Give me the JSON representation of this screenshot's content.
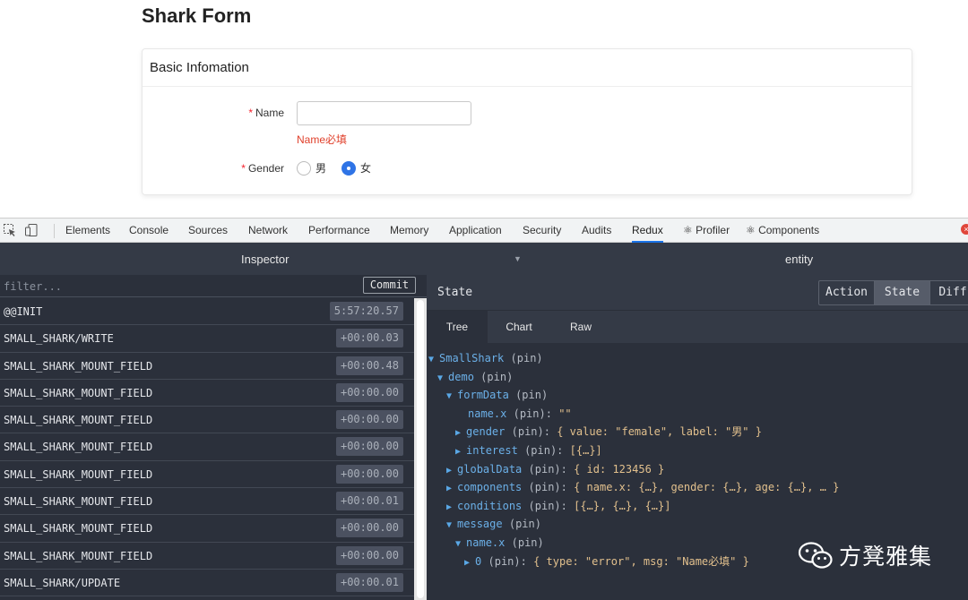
{
  "form": {
    "title": "Shark Form",
    "card_title": "Basic Infomation",
    "name_label": "Name",
    "required_mark": "*",
    "name_value": "",
    "name_error": "Name必填",
    "gender_label": "Gender",
    "gender_options": [
      {
        "label": "男",
        "selected": false
      },
      {
        "label": "女",
        "selected": true
      }
    ]
  },
  "devtools": {
    "tabs": [
      "Elements",
      "Console",
      "Sources",
      "Network",
      "Performance",
      "Memory",
      "Application",
      "Security",
      "Audits",
      "Redux",
      "⚛ Profiler",
      "⚛ Components"
    ],
    "active_tab": "Redux",
    "close_glyph": "×"
  },
  "redux": {
    "inspector_title": "Inspector",
    "entity_title": "entity",
    "filter_placeholder": "filter...",
    "commit_label": "Commit",
    "actions": [
      {
        "name": "@@INIT",
        "time": "5:57:20.57"
      },
      {
        "name": "SMALL_SHARK/WRITE",
        "time": "+00:00.03"
      },
      {
        "name": "SMALL_SHARK_MOUNT_FIELD",
        "time": "+00:00.48"
      },
      {
        "name": "SMALL_SHARK_MOUNT_FIELD",
        "time": "+00:00.00"
      },
      {
        "name": "SMALL_SHARK_MOUNT_FIELD",
        "time": "+00:00.00"
      },
      {
        "name": "SMALL_SHARK_MOUNT_FIELD",
        "time": "+00:00.00"
      },
      {
        "name": "SMALL_SHARK_MOUNT_FIELD",
        "time": "+00:00.00"
      },
      {
        "name": "SMALL_SHARK_MOUNT_FIELD",
        "time": "+00:00.01"
      },
      {
        "name": "SMALL_SHARK_MOUNT_FIELD",
        "time": "+00:00.00"
      },
      {
        "name": "SMALL_SHARK_MOUNT_FIELD",
        "time": "+00:00.00"
      },
      {
        "name": "SMALL_SHARK/UPDATE",
        "time": "+00:00.01"
      }
    ],
    "state_title": "State",
    "mode_buttons": [
      "Action",
      "State",
      "Diff"
    ],
    "active_mode": "State",
    "subtabs": [
      "Tree",
      "Chart",
      "Raw"
    ],
    "active_subtab": "Tree",
    "tree": [
      {
        "arrow": "▼",
        "key": "SmallShark",
        "pin": "(pin)",
        "value": ""
      },
      {
        "arrow": "▼",
        "key": "demo",
        "pin": "(pin)",
        "value": ""
      },
      {
        "arrow": "▼",
        "key": "formData",
        "pin": "(pin)",
        "value": ""
      },
      {
        "arrow": "",
        "key": "name.x",
        "pin": "(pin):",
        "value": "\"\""
      },
      {
        "arrow": "▶",
        "key": "gender",
        "pin": "(pin):",
        "value": "{ value: \"female\", label: \"男\" }"
      },
      {
        "arrow": "▶",
        "key": "interest",
        "pin": "(pin):",
        "value": "[{…}]"
      },
      {
        "arrow": "▶",
        "key": "globalData",
        "pin": "(pin):",
        "value": "{ id: 123456 }"
      },
      {
        "arrow": "▶",
        "key": "components",
        "pin": "(pin):",
        "value": "{ name.x: {…}, gender: {…}, age: {…}, … }"
      },
      {
        "arrow": "▶",
        "key": "conditions",
        "pin": "(pin):",
        "value": "[{…}, {…}, {…}]"
      },
      {
        "arrow": "▼",
        "key": "message",
        "pin": "(pin)",
        "value": ""
      },
      {
        "arrow": "▼",
        "key": "name.x",
        "pin": "(pin)",
        "value": ""
      },
      {
        "arrow": "▶",
        "key": "0",
        "pin": "(pin):",
        "value": "{ type: \"error\", msg: \"Name必填\" }"
      }
    ]
  },
  "watermark": {
    "text": "方凳雅集",
    "icon": "wechat-icon"
  }
}
